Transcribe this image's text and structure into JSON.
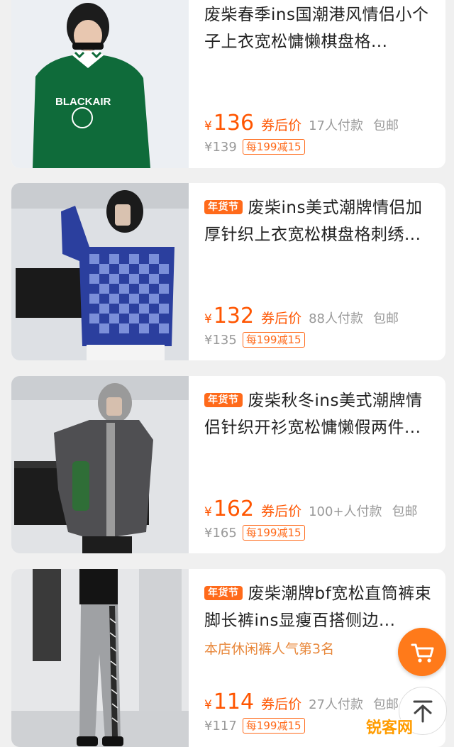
{
  "products": [
    {
      "tag": "",
      "title": "废柴春季ins国潮港风情侣小个子上衣宽松慵懒棋盘格...",
      "subtitle": "",
      "currency": "¥",
      "price": "136",
      "after_coupon": "券后价",
      "sold": "17人付款",
      "shipping": "包邮",
      "original_price": "¥139",
      "coupon": "每199减15",
      "image": "green-checker-collar-sweatshirt"
    },
    {
      "tag": "年货节",
      "title": "废柴ins美式潮牌情侣加厚针织上衣宽松棋盘格刺绣...",
      "subtitle": "",
      "currency": "¥",
      "price": "132",
      "after_coupon": "券后价",
      "sold": "88人付款",
      "shipping": "包邮",
      "original_price": "¥135",
      "coupon": "每199减15",
      "image": "blue-checkerboard-sweater"
    },
    {
      "tag": "年货节",
      "title": "废柴秋冬ins美式潮牌情侣针织开衫宽松慵懒假两件...",
      "subtitle": "",
      "currency": "¥",
      "price": "162",
      "after_coupon": "券后价",
      "sold": "100+人付款",
      "shipping": "包邮",
      "original_price": "¥165",
      "coupon": "每199减15",
      "image": "grey-knit-cardigan"
    },
    {
      "tag": "年货节",
      "title": "废柴潮牌bf宽松直筒裤束脚长裤ins显瘦百搭侧边...",
      "subtitle": "本店休闲裤人气第3名",
      "currency": "¥",
      "price": "114",
      "after_coupon": "券后价",
      "sold": "27人付款",
      "shipping": "包邮",
      "original_price": "¥117",
      "coupon": "每199减15",
      "image": "grey-striped-joggers"
    }
  ],
  "floating": {
    "cart_icon": "shopping-cart-icon",
    "top_icon": "back-to-top-icon"
  },
  "watermark": "锐客网",
  "colors": {
    "accent": "#ff5500",
    "tag_bg": "#ff6a1a",
    "rank_text": "#e8873a",
    "muted": "#999999"
  }
}
